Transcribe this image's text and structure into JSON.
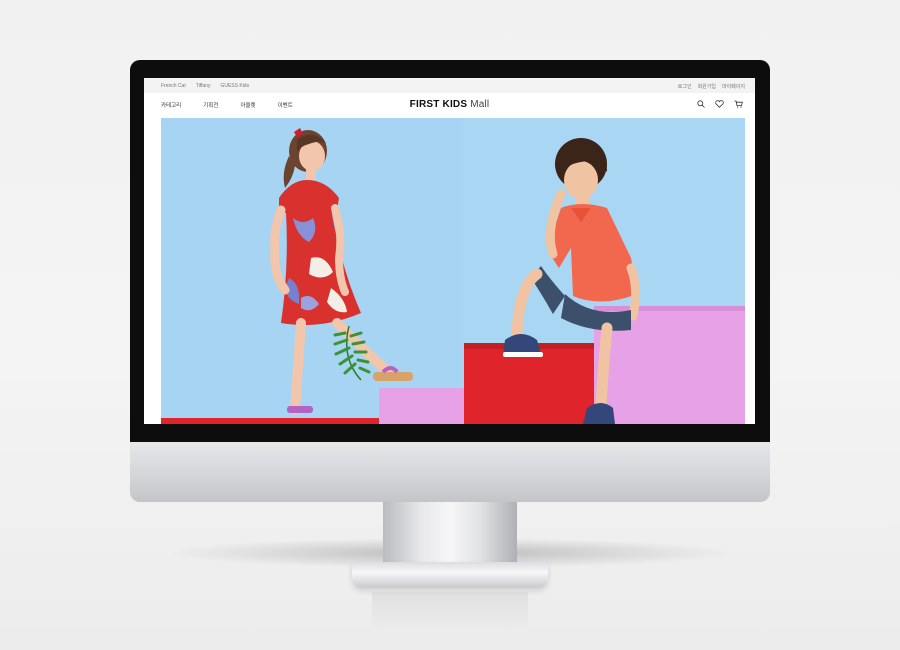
{
  "utility_bar": {
    "brands": [
      "French Cat",
      "Tiffany",
      "GUESS Kids"
    ],
    "account_links": [
      "로그인",
      "회원가입",
      "마이페이지"
    ]
  },
  "nav": {
    "menu": [
      "카테고리",
      "기획전",
      "아울렛",
      "이벤트"
    ],
    "logo_bold": "FIRST KIDS",
    "logo_light": "Mall",
    "icons": [
      "search-icon",
      "heart-icon",
      "cart-icon"
    ]
  },
  "colors": {
    "hero_background": "#a6d4f2",
    "block_red": "#e0242b",
    "block_pink": "#e7a1e7"
  }
}
